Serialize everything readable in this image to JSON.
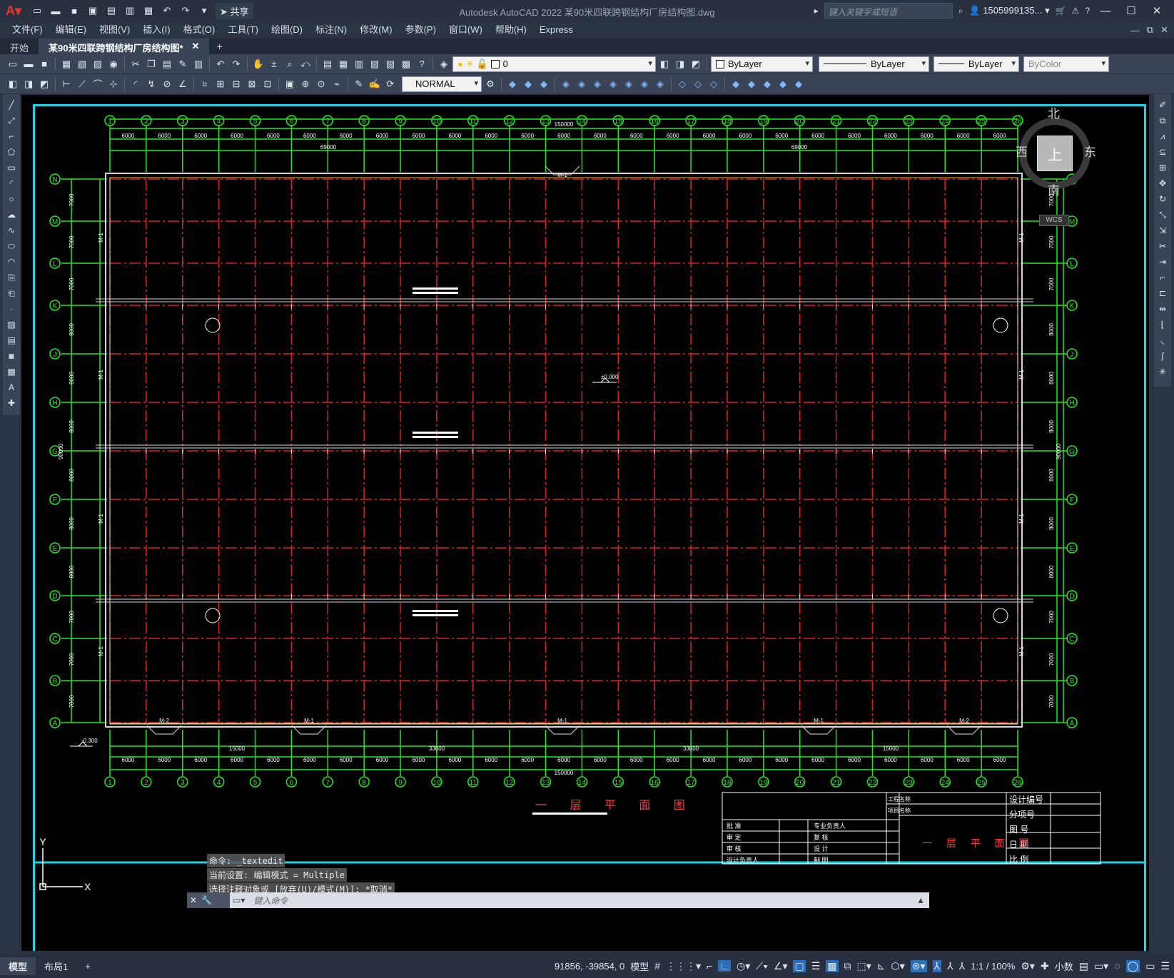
{
  "window": {
    "title": "Autodesk AutoCAD 2022    某90米四联跨钢结构厂房结构图.dwg",
    "share_label": "共享",
    "search_placeholder": "键入关键字或短语",
    "user": "1505999135...",
    "logo": "A"
  },
  "menu": [
    "文件(F)",
    "编辑(E)",
    "视图(V)",
    "插入(I)",
    "格式(O)",
    "工具(T)",
    "绘图(D)",
    "标注(N)",
    "修改(M)",
    "参数(P)",
    "窗口(W)",
    "帮助(H)",
    "Express"
  ],
  "tabs": {
    "start": "开始",
    "active": "某90米四联跨钢结构厂房结构图*",
    "plus": "+"
  },
  "toolbar": {
    "layer_value": "0",
    "color_value": "ByLayer",
    "linetype_value": "ByLayer",
    "lineweight_value": "ByLayer",
    "plotstyle_value": "ByColor",
    "dimstyle_value": "NORMAL"
  },
  "viewcube": {
    "north": "北",
    "south": "南",
    "east": "东",
    "west": "西",
    "top": "上",
    "wcs": "WCS"
  },
  "drawing": {
    "grid_cols": [
      "1",
      "2",
      "3",
      "4",
      "5",
      "6",
      "7",
      "8",
      "9",
      "10",
      "11",
      "12",
      "13",
      "14",
      "15",
      "16",
      "17",
      "18",
      "19",
      "20",
      "21",
      "22",
      "23",
      "24",
      "25",
      "26"
    ],
    "grid_rows": [
      "N",
      "M",
      "L",
      "K",
      "J",
      "H",
      "G",
      "F",
      "E",
      "D",
      "C",
      "B",
      "A"
    ],
    "bay_dim": "6000",
    "total_length": "150000",
    "half_length": "69000",
    "total_width": "90000",
    "row_dims": [
      "7000",
      "7000",
      "7000",
      "8000",
      "8000",
      "8000",
      "8000",
      "8000",
      "8000",
      "7000",
      "7000",
      "7000"
    ],
    "level_mark": "±0.000",
    "low_level": "-0.300",
    "title": "一 层 平 面 图",
    "bottom_segs": [
      "15000",
      "33000",
      "33000",
      "15000"
    ],
    "door_label": "M-1",
    "door2": "M-2"
  },
  "title_block": {
    "labels_left": [
      "批  准",
      "审  定",
      "审  核",
      "设计负责人"
    ],
    "labels_mid": [
      "专业负责人",
      "复  核",
      "设  计",
      "制  图"
    ],
    "project_labels": [
      "工程名称",
      "项目名称"
    ],
    "right_labels": [
      "设计编号",
      "分项号",
      "图  号",
      "日  期",
      "比  例"
    ],
    "sheet_title": "一 层 平 面 图"
  },
  "command": {
    "history": [
      "命令: _textedit",
      "当前设置: 编辑模式 = Multiple",
      "选择注释对象或 [放弃(U)/模式(M)]: *取消*"
    ],
    "placeholder": "键入命令"
  },
  "status": {
    "tab_model": "模型",
    "tab_layout": "布局1",
    "coords": "91856, -39854, 0",
    "space": "模型",
    "scale": "1:1 / 100%",
    "units": "小数"
  },
  "ucs": {
    "x": "X",
    "y": "Y"
  }
}
